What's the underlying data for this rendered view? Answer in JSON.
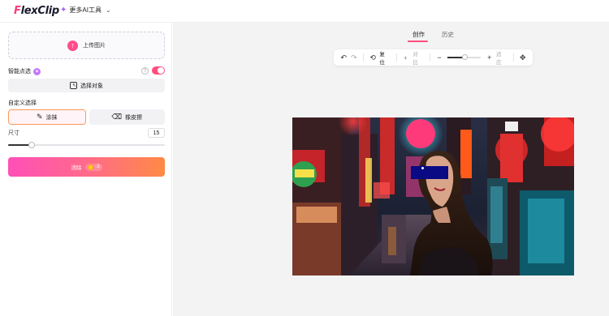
{
  "header": {
    "logo": "FlexClip",
    "more_ai": "更多AI工具"
  },
  "left": {
    "upload_label": "上传图片",
    "smart_select_label": "智能点选",
    "select_object_label": "选择对象",
    "custom_select_label": "自定义选择",
    "paint_label": "涂抹",
    "eraser_label": "橡皮擦",
    "size_label": "尺寸",
    "size_value": "15",
    "size_level_fraction": 0.15,
    "erase_label": "消除",
    "erase_cost": "-3"
  },
  "right": {
    "tabs": [
      {
        "label": "创作",
        "active": true
      },
      {
        "label": "历史",
        "active": false
      }
    ],
    "toolbar": {
      "reset_label": "复位",
      "compare_label": "对比",
      "fit_label": "适应"
    }
  },
  "colors": {
    "accent": "#ff4d7e",
    "erase_gradient_start": "#ff4fb8",
    "erase_gradient_end": "#ff8a45",
    "mask": "#0a0a85"
  }
}
